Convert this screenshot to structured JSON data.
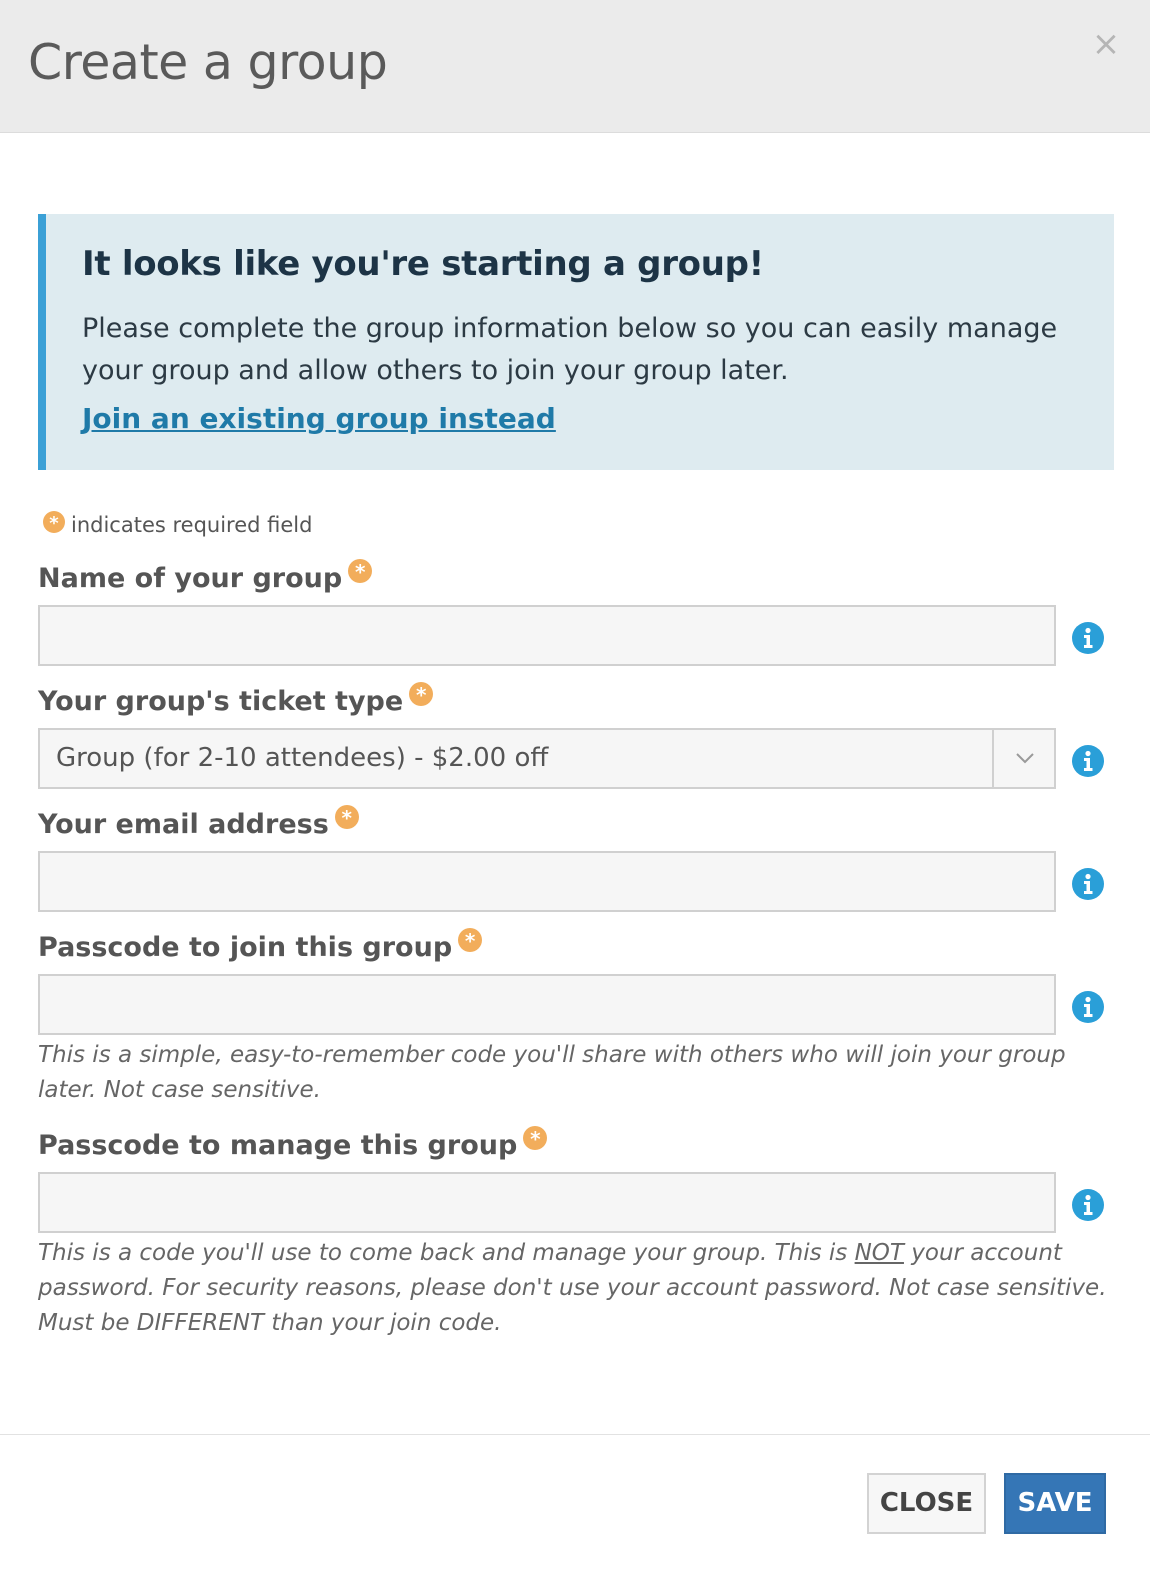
{
  "modal": {
    "title": "Create a group",
    "close_icon": "×"
  },
  "callout": {
    "title": "It looks like you're starting a group!",
    "body": "Please complete the group information below so you can easily manage your group and allow others to join your group later.",
    "link": "Join an existing group instead"
  },
  "required_note": {
    "badge": "*",
    "text": "indicates required field"
  },
  "fields": [
    {
      "label": "Name of your group",
      "value": "",
      "placeholder": ""
    },
    {
      "label": "Your group's ticket type",
      "value": "Group (for 2-10 attendees) - $2.00 off"
    },
    {
      "label": "Your email address",
      "value": "",
      "placeholder": ""
    },
    {
      "label": "Passcode to join this group",
      "value": "",
      "placeholder": "",
      "help": "This is a simple, easy-to-remember code you'll share with others who will join your group later. Not case sensitive."
    },
    {
      "label": "Passcode to manage this group",
      "value": "",
      "placeholder": "",
      "help_pre": "This is a code you'll use to come back and manage your group. This is ",
      "help_emphasis": "NOT",
      "help_post": " your account password. For security reasons, please don't use your account password. Not case sensitive. Must be DIFFERENT than your join code."
    }
  ],
  "footer": {
    "close_label": "CLOSE",
    "save_label": "SAVE"
  },
  "colors": {
    "header_bg": "#ebebeb",
    "callout_bg": "#deebf0",
    "callout_border": "#3ba0d6",
    "link": "#1f7aa8",
    "required_badge": "#f2ad5b",
    "info_icon": "#2a9fd8",
    "primary_button": "#3576b6"
  },
  "icons": {
    "close": "close-icon",
    "info": "info-icon",
    "required": "asterisk-icon",
    "select_arrow": "chevron-down-icon"
  }
}
